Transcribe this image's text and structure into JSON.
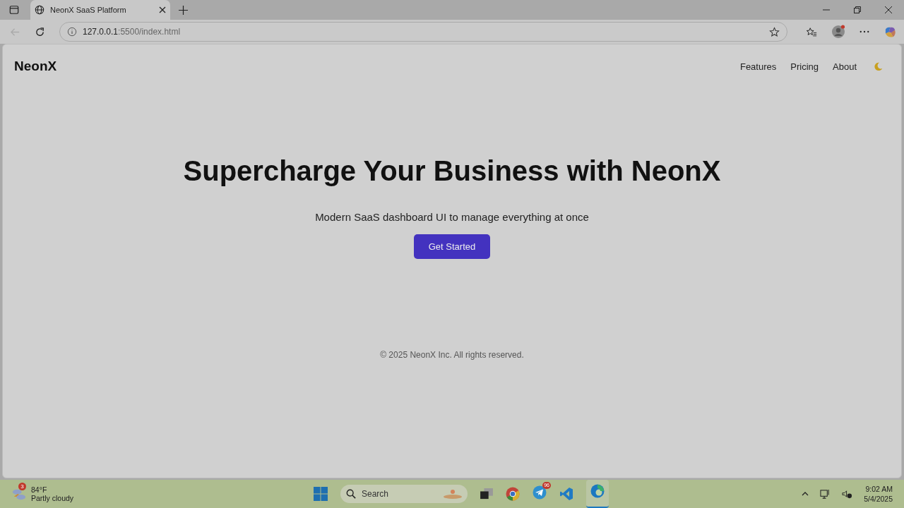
{
  "browser": {
    "tab_title": "NeonX SaaS Platform",
    "address": {
      "host": "127.0.0.1",
      "rest": ":5500/index.html"
    }
  },
  "page": {
    "brand": "NeonX",
    "nav": [
      {
        "label": "Features"
      },
      {
        "label": "Pricing"
      },
      {
        "label": "About"
      }
    ],
    "hero": {
      "title": "Supercharge Your Business with NeonX",
      "subtitle": "Modern SaaS dashboard UI to manage everything at once",
      "button": "Get Started"
    },
    "footer": "© 2025 NeonX Inc. All rights reserved."
  },
  "taskbar": {
    "weather": {
      "badge": "3",
      "temp": "84°F",
      "condition": "Partly cloudy"
    },
    "search": "Search",
    "telegram_badge": "96",
    "time": "9:02 AM",
    "date": "5/4/2025"
  }
}
